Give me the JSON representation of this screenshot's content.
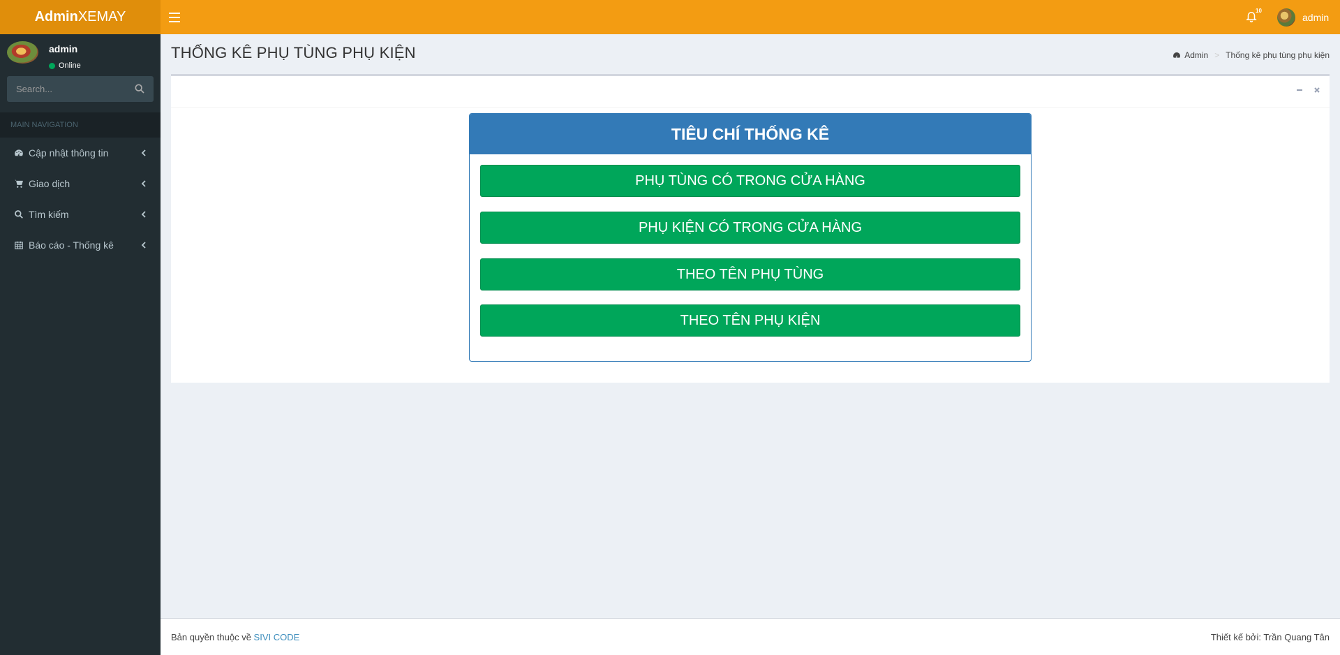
{
  "header": {
    "logo_bold": "Admin",
    "logo_rest": "XEMAY",
    "notification_count": "10",
    "user_name": "admin",
    "brand_color": "#f39c12"
  },
  "sidebar": {
    "user": {
      "name": "admin",
      "status": "Online"
    },
    "search": {
      "placeholder": "Search..."
    },
    "nav_header": "MAIN NAVIGATION",
    "items": [
      {
        "label": "Cập nhật thông tin",
        "icon": "dashboard-icon"
      },
      {
        "label": "Giao dịch",
        "icon": "shopping-cart-icon"
      },
      {
        "label": "Tìm kiếm",
        "icon": "search-icon"
      },
      {
        "label": "Báo cáo - Thống kê",
        "icon": "calendar-icon"
      }
    ]
  },
  "content": {
    "page_title": "THỐNG KÊ PHỤ TÙNG PHỤ KIỆN",
    "breadcrumb": {
      "home": "Admin",
      "current": "Thống kê phụ tùng phụ kiện"
    },
    "panel": {
      "title": "TIÊU CHÍ THỐNG KÊ",
      "buttons": [
        "PHỤ TÙNG CÓ TRONG CỬA HÀNG",
        "PHỤ KIỆN CÓ TRONG CỬA HÀNG",
        "THEO TÊN PHỤ TÙNG",
        "THEO TÊN PHỤ KIỆN"
      ]
    }
  },
  "footer": {
    "copyright_prefix": "Bản quyền thuộc về",
    "copyright_link": "SIVI CODE",
    "designer": "Thiết kế bởi: Trần Quang Tân"
  }
}
